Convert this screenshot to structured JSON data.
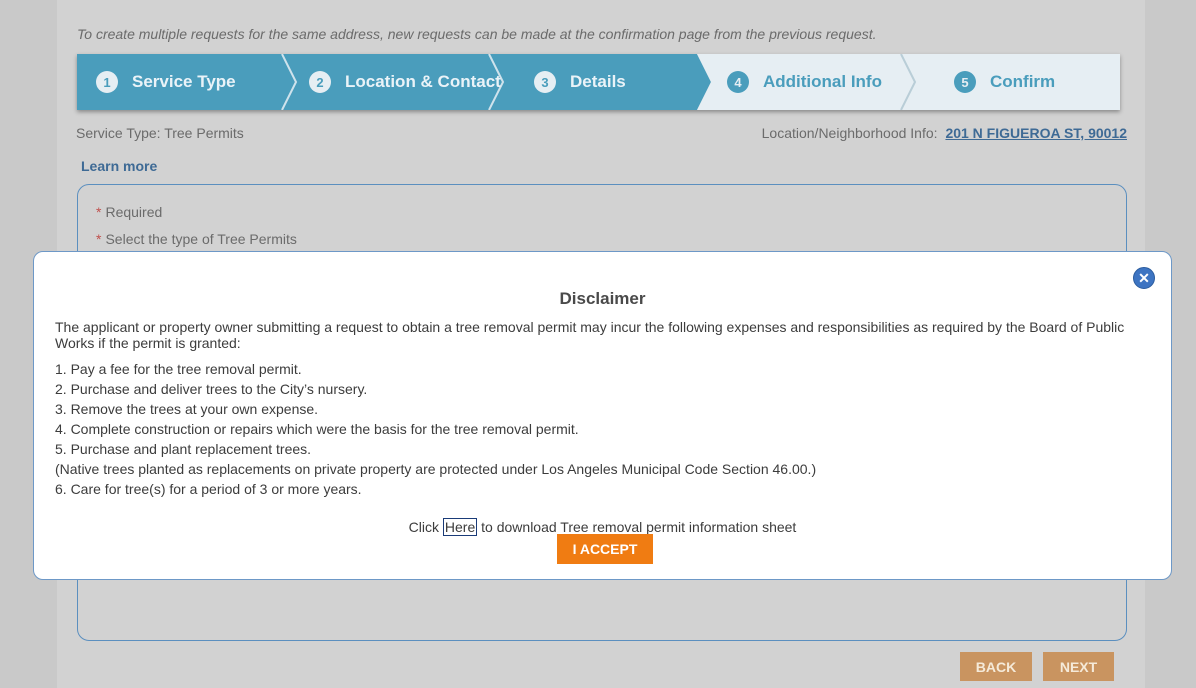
{
  "intro_note": "To create multiple requests for the same address, new requests can be made at the confirmation page from the previous request.",
  "wizard": {
    "steps": [
      {
        "num": "1",
        "label": "Service Type"
      },
      {
        "num": "2",
        "label": "Location & Contact"
      },
      {
        "num": "3",
        "label": "Details"
      },
      {
        "num": "4",
        "label": "Additional Info"
      },
      {
        "num": "5",
        "label": "Confirm"
      }
    ]
  },
  "service_type": {
    "label": "Service Type:",
    "value": "Tree Permits"
  },
  "location": {
    "label": "Location/Neighborhood Info:",
    "value": "201 N FIGUEROA ST, 90012"
  },
  "learn_more": "Learn more",
  "form": {
    "required_label": "Required",
    "select_label": "Select the type of Tree Permits"
  },
  "buttons": {
    "back": "BACK",
    "next": "NEXT"
  },
  "modal": {
    "title": "Disclaimer",
    "intro": "The applicant or property owner submitting a request to obtain a tree removal permit may incur the following expenses and responsibilities as required by the Board of Public Works if the permit is granted:",
    "items": [
      "1. Pay a fee for the tree removal permit.",
      "2. Purchase and deliver trees to the City’s nursery.",
      "3. Remove the trees at your own expense.",
      "4. Complete construction or repairs which were the basis for the tree removal permit.",
      "5. Purchase and plant replacement trees.",
      "(Native trees planted as replacements on private property are protected under Los Angeles Municipal Code Section 46.00.)",
      "6. Care for tree(s) for a period of 3 or more years."
    ],
    "download_prefix": "Click",
    "download_link": "Here",
    "download_suffix": "to download Tree removal permit information sheet",
    "accept_label": "I ACCEPT",
    "close_glyph": "✕"
  },
  "colors": {
    "wizard_active": "#4a9dbc",
    "wizard_inactive": "#e6eef3",
    "accent_orange": "#f07c12",
    "link_blue": "#3e6a95"
  }
}
